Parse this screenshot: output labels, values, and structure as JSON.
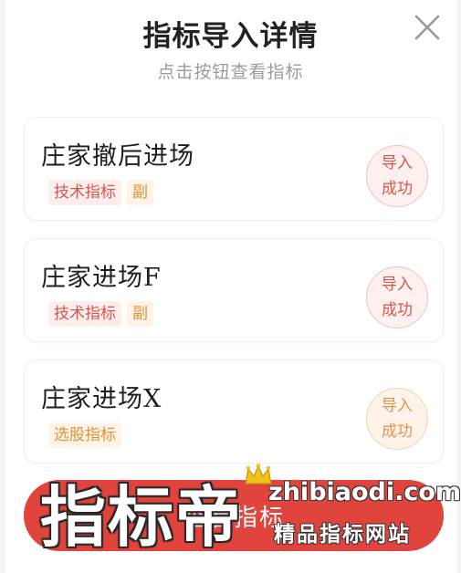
{
  "dialog": {
    "title": "指标导入详情",
    "subtitle": "点击按钮查看指标",
    "close_icon": "close-icon"
  },
  "items": [
    {
      "name": "庄家撤后进场",
      "tags": [
        {
          "label": "技术指标",
          "color": "#d8564d"
        },
        {
          "label": "副",
          "color": "#e0933a"
        }
      ],
      "status": {
        "line1": "导入",
        "line2": "成功",
        "color": "#d8564d"
      }
    },
    {
      "name": "庄家进场F",
      "tags": [
        {
          "label": "技术指标",
          "color": "#d8564d"
        },
        {
          "label": "副",
          "color": "#e0933a"
        }
      ],
      "status": {
        "line1": "导入",
        "line2": "成功",
        "color": "#d8564d"
      }
    },
    {
      "name": "庄家进场X",
      "tags": [
        {
          "label": "选股指标",
          "color": "#e0933a"
        }
      ],
      "status": {
        "line1": "导入",
        "line2": "成功",
        "color": "#e39550"
      }
    }
  ],
  "bottom_button": {
    "label": "查看指标",
    "color": "#e0443c"
  },
  "watermark": {
    "logo": "指标帝",
    "domain": "zhibiaodi.com",
    "slogan": "精品指标网站"
  }
}
